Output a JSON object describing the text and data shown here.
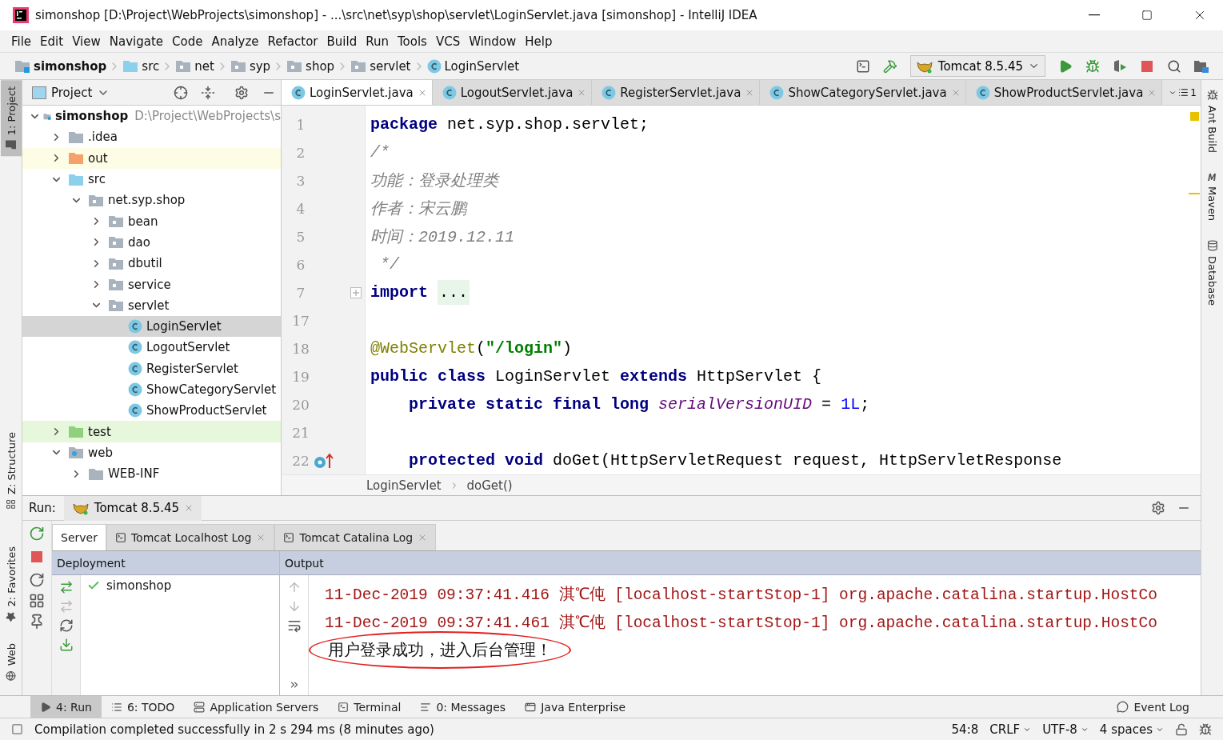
{
  "window": {
    "title": "simonshop [D:\\Project\\WebProjects\\simonshop] - ...\\src\\net\\syp\\shop\\servlet\\LoginServlet.java [simonshop] - IntelliJ IDEA"
  },
  "menu": [
    "File",
    "Edit",
    "View",
    "Navigate",
    "Code",
    "Analyze",
    "Refactor",
    "Build",
    "Run",
    "Tools",
    "VCS",
    "Window",
    "Help"
  ],
  "breadcrumbs": [
    {
      "label": "simonshop",
      "kind": "module"
    },
    {
      "label": "src",
      "kind": "source"
    },
    {
      "label": "net",
      "kind": "package"
    },
    {
      "label": "syp",
      "kind": "package"
    },
    {
      "label": "shop",
      "kind": "package"
    },
    {
      "label": "servlet",
      "kind": "package"
    },
    {
      "label": "LoginServlet",
      "kind": "class"
    }
  ],
  "run_config": {
    "label": "Tomcat 8.5.45"
  },
  "left_tool_windows": [
    {
      "label": "1: Project",
      "kind": "project",
      "selected": true
    },
    {
      "label": "Z: Structure",
      "kind": "structure",
      "selected": false
    },
    {
      "label": "2: Favorites",
      "kind": "favorites",
      "selected": false
    },
    {
      "label": "Web",
      "kind": "web",
      "selected": false
    }
  ],
  "right_tool_windows": [
    {
      "label": "Ant Build",
      "kind": "ant"
    },
    {
      "label": "Maven",
      "kind": "maven"
    },
    {
      "label": "Database",
      "kind": "database"
    }
  ],
  "project_panel": {
    "title": "Project",
    "tree": [
      {
        "label": "simonshop",
        "path": "D:\\Project\\WebProjects\\s",
        "kind": "module",
        "expanded": true,
        "selected": false,
        "children": [
          {
            "label": ".idea",
            "kind": "folder",
            "expanded": false,
            "selected": false
          },
          {
            "label": "out",
            "kind": "excluded",
            "expanded": false,
            "selected": false
          },
          {
            "label": "src",
            "kind": "source",
            "expanded": true,
            "selected": false,
            "children": [
              {
                "label": "net.syp.shop",
                "kind": "package",
                "expanded": true,
                "selected": false,
                "children": [
                  {
                    "label": "bean",
                    "kind": "package",
                    "expanded": false,
                    "selected": false
                  },
                  {
                    "label": "dao",
                    "kind": "package",
                    "expanded": false,
                    "selected": false
                  },
                  {
                    "label": "dbutil",
                    "kind": "package",
                    "expanded": false,
                    "selected": false
                  },
                  {
                    "label": "service",
                    "kind": "package",
                    "expanded": false,
                    "selected": false
                  },
                  {
                    "label": "servlet",
                    "kind": "package",
                    "expanded": true,
                    "selected": false,
                    "children": [
                      {
                        "label": "LoginServlet",
                        "kind": "class",
                        "selected": true
                      },
                      {
                        "label": "LogoutServlet",
                        "kind": "class",
                        "selected": false
                      },
                      {
                        "label": "RegisterServlet",
                        "kind": "class",
                        "selected": false
                      },
                      {
                        "label": "ShowCategoryServlet",
                        "kind": "class",
                        "selected": false
                      },
                      {
                        "label": "ShowProductServlet",
                        "kind": "class",
                        "selected": false
                      }
                    ]
                  }
                ]
              }
            ]
          },
          {
            "label": "test",
            "kind": "test",
            "expanded": false,
            "selected": false
          },
          {
            "label": "web",
            "kind": "web",
            "expanded": true,
            "selected": false,
            "children": [
              {
                "label": "WEB-INF",
                "kind": "folder",
                "expanded": false,
                "selected": false
              }
            ]
          }
        ]
      }
    ]
  },
  "editor": {
    "tabs": [
      {
        "label": "LoginServlet.java",
        "selected": true
      },
      {
        "label": "LogoutServlet.java",
        "selected": false
      },
      {
        "label": "RegisterServlet.java",
        "selected": false
      },
      {
        "label": "ShowCategoryServlet.java",
        "selected": false
      },
      {
        "label": "ShowProductServlet.java",
        "selected": false
      }
    ],
    "hidden_tab_count": "1",
    "lines": [
      {
        "number": "1",
        "tokens": [
          {
            "kind": "keyword",
            "text": "package"
          },
          {
            "kind": "plain",
            "text": " net.syp.shop.servlet;"
          }
        ]
      },
      {
        "number": "2",
        "tokens": [
          {
            "kind": "comment",
            "text": "/*"
          }
        ]
      },
      {
        "number": "3",
        "tokens": [
          {
            "kind": "comment",
            "text": "功能：登录处理类"
          }
        ]
      },
      {
        "number": "4",
        "tokens": [
          {
            "kind": "comment",
            "text": "作者：宋云鹏"
          }
        ]
      },
      {
        "number": "5",
        "tokens": [
          {
            "kind": "comment",
            "text": "时间：2019.12.11"
          }
        ]
      },
      {
        "number": "6",
        "tokens": [
          {
            "kind": "comment",
            "text": " */"
          }
        ]
      },
      {
        "number": "7",
        "collapsed_fold": true,
        "tokens": [
          {
            "kind": "keyword",
            "text": "import"
          },
          {
            "kind": "folded",
            "text": "..."
          }
        ]
      },
      {
        "number": "17"
      },
      {
        "number": "18",
        "tokens": [
          {
            "kind": "annotation",
            "text": "@WebServlet"
          },
          {
            "kind": "plain",
            "text": "("
          },
          {
            "kind": "string",
            "text": "\"/login\""
          },
          {
            "kind": "plain",
            "text": ")"
          }
        ]
      },
      {
        "number": "19",
        "tokens": [
          {
            "kind": "keyword",
            "text": "public class"
          },
          {
            "kind": "plain",
            "text": " LoginServlet "
          },
          {
            "kind": "keyword",
            "text": "extends"
          },
          {
            "kind": "plain",
            "text": " HttpServlet {"
          }
        ]
      },
      {
        "number": "20",
        "tokens": [
          {
            "kind": "keyword",
            "text": "    private static final long"
          },
          {
            "kind": "field",
            "text": " serialVersionUID"
          },
          {
            "kind": "plain",
            "text": " = "
          },
          {
            "kind": "number",
            "text": "1L"
          },
          {
            "kind": "plain",
            "text": ";"
          }
        ]
      },
      {
        "number": "21"
      },
      {
        "number": "22",
        "override_marker": true,
        "tokens": [
          {
            "kind": "keyword",
            "text": "    protected void"
          },
          {
            "kind": "plain",
            "text": " doGet(HttpServletRequest request, HttpServletResponse"
          }
        ]
      }
    ],
    "breadcrumb": [
      "LoginServlet",
      "doGet()"
    ]
  },
  "run_panel": {
    "label": "Run:",
    "config_tab": "Tomcat 8.5.45",
    "tabs": [
      {
        "label": "Server",
        "kind": "server",
        "selected": true
      },
      {
        "label": "Tomcat Localhost Log",
        "kind": "log",
        "selected": false
      },
      {
        "label": "Tomcat Catalina Log",
        "kind": "log",
        "selected": false
      }
    ],
    "deployment": {
      "header": "Deployment",
      "items": [
        {
          "label": "simonshop"
        }
      ]
    },
    "output": {
      "header": "Output",
      "lines": [
        {
          "kind": "log",
          "circled": false,
          "text": "11-Dec-2019 09:37:41.416 淇℃伅 [localhost-startStop-1] org.apache.catalina.startup.HostCo"
        },
        {
          "kind": "log",
          "circled": false,
          "text": "11-Dec-2019 09:37:41.461 淇℃伅 [localhost-startStop-1] org.apache.catalina.startup.HostCo"
        },
        {
          "kind": "plain",
          "circled": true,
          "text": "用户登录成功，进入后台管理！"
        }
      ]
    }
  },
  "bottom_tabs": [
    {
      "label": "4: Run",
      "kind": "run",
      "selected": true
    },
    {
      "label": "6: TODO",
      "kind": "todo",
      "selected": false
    },
    {
      "label": "Application Servers",
      "kind": "servers",
      "selected": false
    },
    {
      "label": "Terminal",
      "kind": "terminal",
      "selected": false
    },
    {
      "label": "0: Messages",
      "kind": "messages",
      "selected": false
    },
    {
      "label": "Java Enterprise",
      "kind": "javaee",
      "selected": false
    }
  ],
  "event_log": "Event Log",
  "status_bar": {
    "message": "Compilation completed successfully in 2 s 294 ms (8 minutes ago)",
    "position": "54:8",
    "line_separator": "CRLF",
    "encoding": "UTF-8",
    "indent": "4 spaces"
  }
}
